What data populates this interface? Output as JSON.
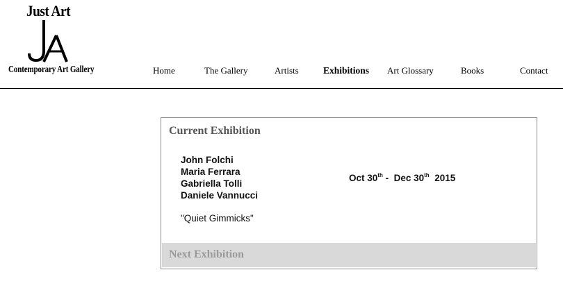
{
  "logo": {
    "top_text": "Just Art",
    "mark_text": "JA",
    "bottom_text": "Contemporary Art Gallery"
  },
  "nav": {
    "items": [
      {
        "label": "Home",
        "active": false
      },
      {
        "label": "The Gallery",
        "active": false
      },
      {
        "label": "Artists",
        "active": false
      },
      {
        "label": "Exhibitions",
        "active": true
      },
      {
        "label": "Art Glossary",
        "active": false
      },
      {
        "label": "Books",
        "active": false
      },
      {
        "label": "Contact",
        "active": false
      }
    ]
  },
  "current_exhibition": {
    "heading": "Current Exhibition",
    "artists": [
      "John Folchi",
      "Maria Ferrara",
      "Gabriella Tolli",
      "Daniele Vannucci"
    ],
    "title": "\"Quiet Gimmicks\"",
    "dates": {
      "start_day": "Oct 30",
      "start_suffix": "th",
      "separator": " -  ",
      "end_day": "Dec 30",
      "end_suffix": "th",
      "year": "2015"
    }
  },
  "next_exhibition": {
    "heading": "Next Exhibition"
  },
  "colors": {
    "panel_border": "#8a8a8a",
    "current_heading": "#555555",
    "next_bar": "#d9d9d9",
    "next_heading": "#9a9a9a"
  }
}
